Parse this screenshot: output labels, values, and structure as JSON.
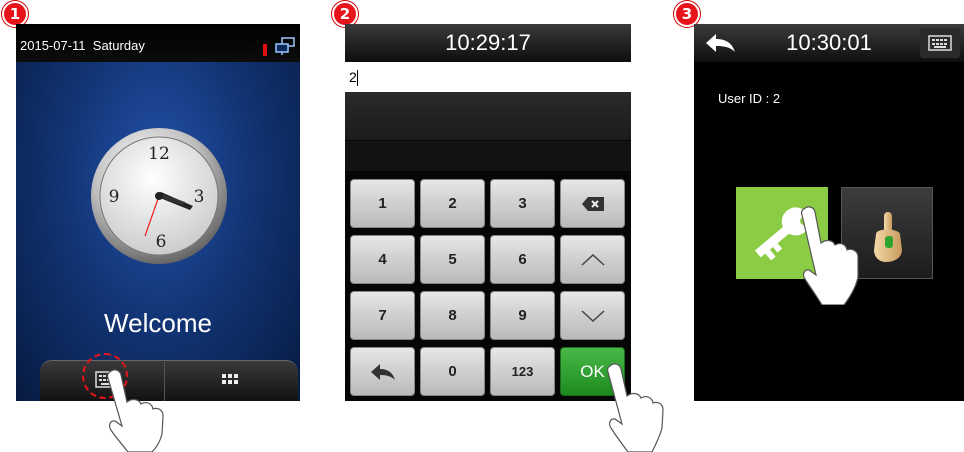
{
  "steps": [
    "1",
    "2",
    "3"
  ],
  "screen1": {
    "date": "2015-07-11",
    "weekday": "Saturday",
    "clock_numerals": [
      "12",
      "3",
      "6",
      "9"
    ],
    "welcome": "Welcome",
    "icons": [
      "alert-icon",
      "network-icon",
      "keyboard-icon",
      "menu-grid-icon"
    ]
  },
  "screen2": {
    "time": "10:29:17",
    "input_value": "2",
    "keypad": [
      [
        "1",
        "2",
        "3",
        "backspace-icon"
      ],
      [
        "4",
        "5",
        "6",
        "up-arrow-icon"
      ],
      [
        "7",
        "8",
        "9",
        "down-arrow-icon"
      ],
      [
        "back-icon",
        "0",
        "123",
        "OK"
      ]
    ],
    "ok_color": "#2a9a2a"
  },
  "screen3": {
    "time": "10:30:01",
    "user_id_label": "User ID : 2",
    "icons": [
      "back-icon",
      "keyboard-icon",
      "password-key-icon",
      "fingerprint-finger-icon"
    ],
    "password_tile_color": "#8ccc44"
  },
  "colors": {
    "step_badge": "#e8141b",
    "highlight_circle": "#e8141b"
  }
}
